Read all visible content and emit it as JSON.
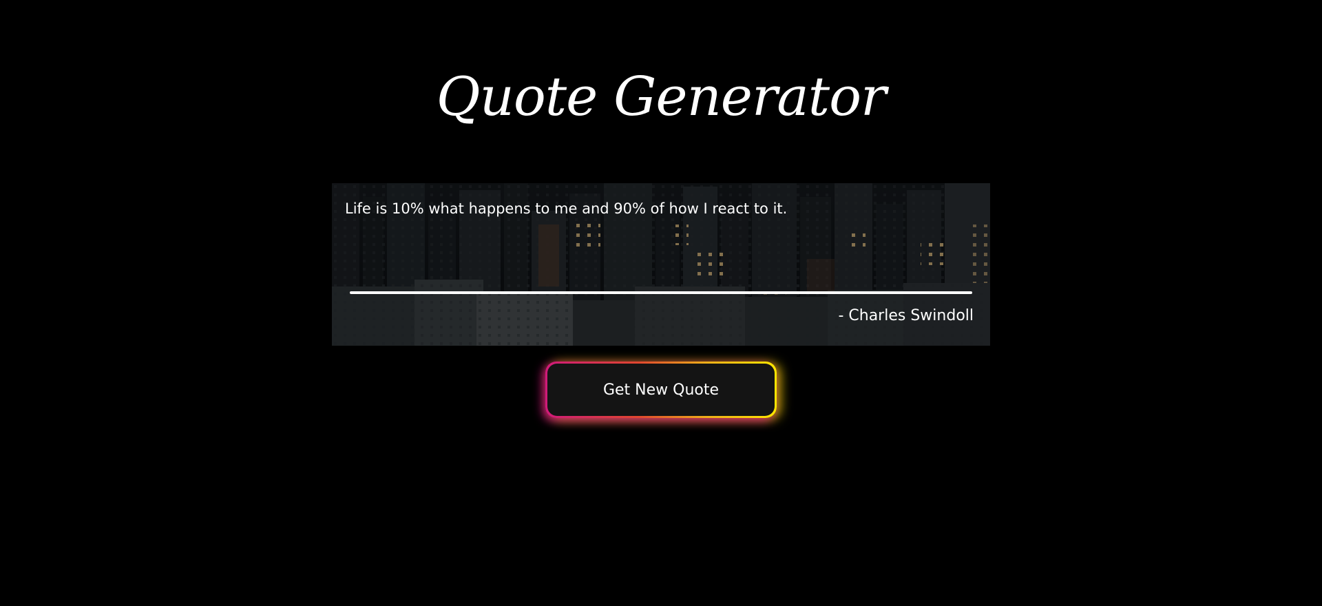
{
  "header": {
    "title": "Quote Generator"
  },
  "quote": {
    "text": "Life is 10% what happens to me and 90% of how I react to it.",
    "author": "- Charles Swindoll"
  },
  "actions": {
    "new_quote_label": "Get New Quote"
  },
  "colors": {
    "background": "#000000",
    "text": "#ffffff",
    "button_bg": "#141414",
    "glow_start": "#d01a7a",
    "glow_end": "#ffe600"
  }
}
